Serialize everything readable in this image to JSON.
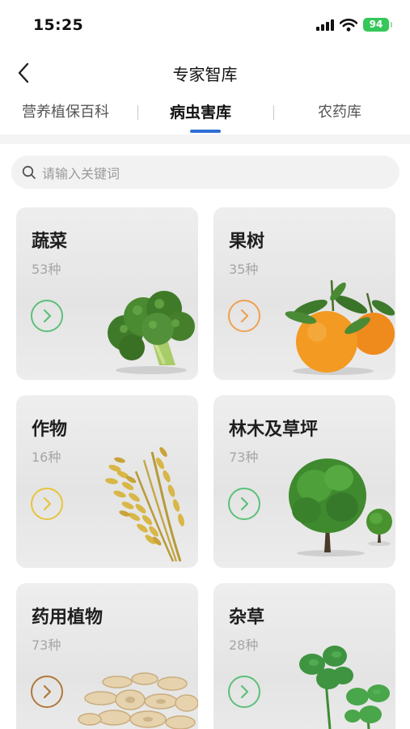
{
  "status_bar": {
    "time": "15:25",
    "battery": "94"
  },
  "nav": {
    "title": "专家智库"
  },
  "tabs": [
    {
      "label": "营养植保百科"
    },
    {
      "label": "病虫害库"
    },
    {
      "label": "农药库"
    }
  ],
  "search": {
    "placeholder": "请输入关键词"
  },
  "categories": [
    {
      "title": "蔬菜",
      "count": "53种",
      "arrow_color": "#5cc07a"
    },
    {
      "title": "果树",
      "count": "35种",
      "arrow_color": "#f0a050"
    },
    {
      "title": "作物",
      "count": "16种",
      "arrow_color": "#e8c43c"
    },
    {
      "title": "林木及草坪",
      "count": "73种",
      "arrow_color": "#5cc07a"
    },
    {
      "title": "药用植物",
      "count": "73种",
      "arrow_color": "#b07a3a"
    },
    {
      "title": "杂草",
      "count": "28种",
      "arrow_color": "#5cc07a"
    }
  ],
  "colors": {
    "accent": "#2f6fd6"
  },
  "icons": {
    "back": "chevron-left-icon",
    "search": "search-icon",
    "arrow": "chevron-right-circle-icon",
    "signal": "signal-icon",
    "wifi": "wifi-icon",
    "battery": "battery-icon"
  }
}
